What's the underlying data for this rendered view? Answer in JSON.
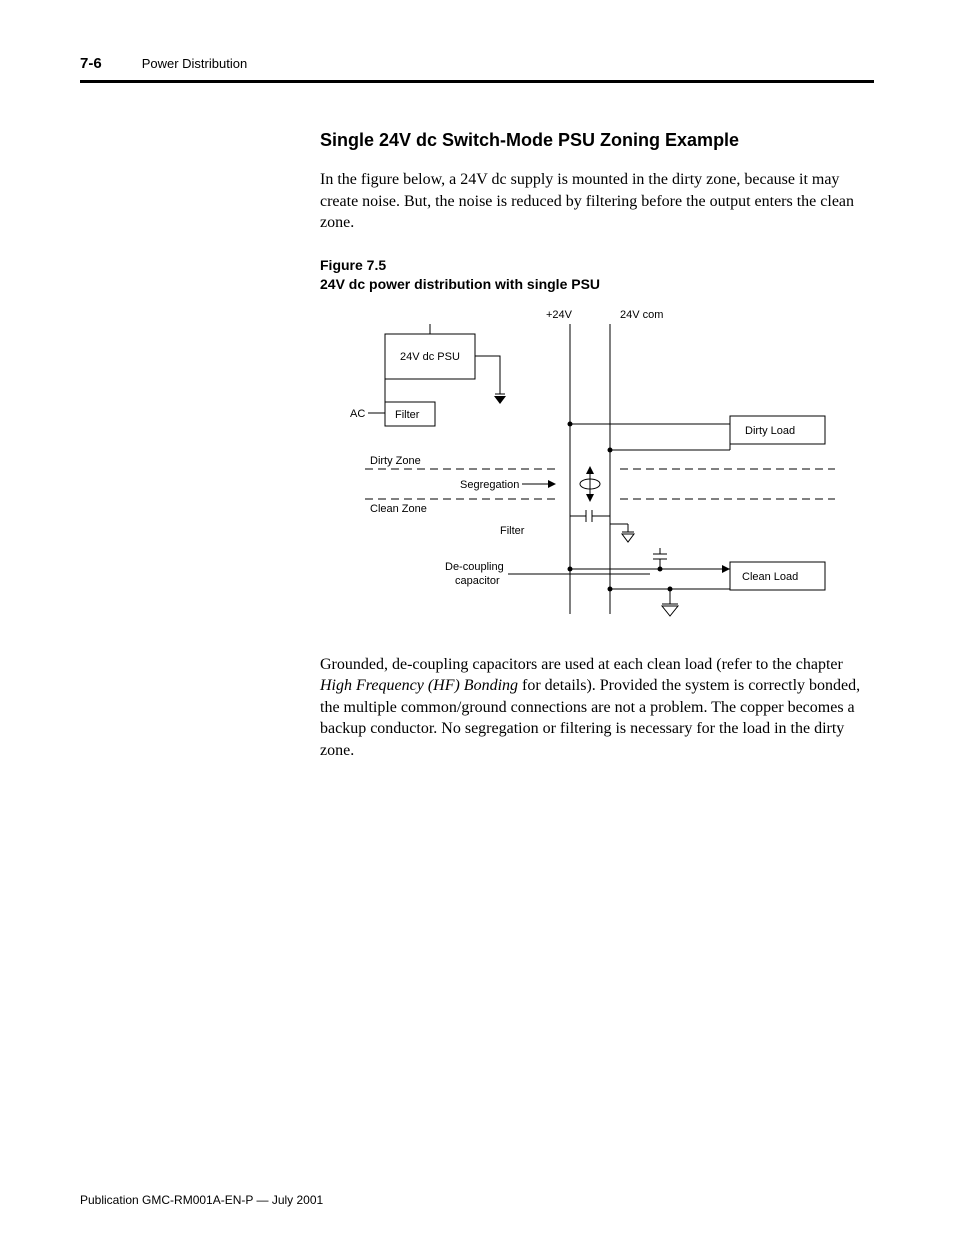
{
  "header": {
    "page_num": "7-6",
    "chapter": "Power Distribution"
  },
  "section_title": "Single 24V dc Switch-Mode PSU Zoning Example",
  "para1": "In the figure below, a 24V dc supply is mounted in the dirty zone, because it may create noise. But, the noise is reduced by filtering before the output enters the clean zone.",
  "figure": {
    "num": "Figure 7.5",
    "caption": "24V dc power distribution with single PSU",
    "labels": {
      "psu": "24V dc PSU",
      "ac": "AC",
      "filter_top": "Filter",
      "dirty_zone": "Dirty Zone",
      "clean_zone": "Clean Zone",
      "segregation": "Segregation",
      "filter_bottom": "Filter",
      "decoupling1": "De-coupling",
      "decoupling2": "capacitor",
      "plus24": "+24V",
      "com24": "24V com",
      "dirty_load": "Dirty Load",
      "clean_load": "Clean Load"
    }
  },
  "para2_a": "Grounded, de-coupling capacitors are used at each clean load (refer to the chapter ",
  "para2_em": "High Frequency (HF) Bonding",
  "para2_b": " for details). Provided the system is correctly bonded, the multiple common/ground connections are not a problem. The copper becomes a backup conductor. No segregation or filtering is necessary for the load in the dirty zone.",
  "footer": "Publication GMC-RM001A-EN-P — July 2001"
}
